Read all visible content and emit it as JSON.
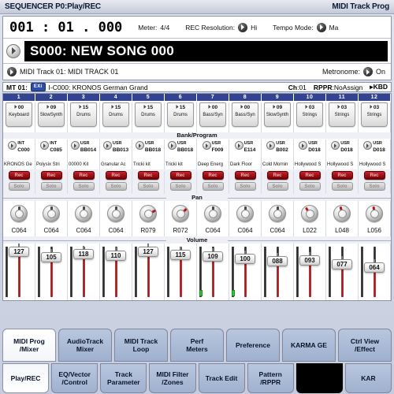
{
  "titlebar": {
    "left": "SEQUENCER P0:Play/REC",
    "right": "MIDI Track Prog"
  },
  "transport": {
    "locate": "001 : 01 . 000",
    "meter_label": "Meter:",
    "meter_value": "4/4",
    "rec_res_label": "REC Resolution:",
    "rec_res_value": "Hi",
    "tempo_mode_label": "Tempo Mode:",
    "tempo_mode_value": "Ma"
  },
  "song": {
    "name": "S000: NEW SONG 000"
  },
  "track_line": {
    "text": "MIDI Track 01: MIDI TRACK 01",
    "metronome_label": "Metronome:",
    "metronome_value": "On"
  },
  "mt_bar": {
    "mt": "MT 01:",
    "badge": "EXi",
    "program": "I-C000: KRONOS German Grand",
    "ch_label": "Ch",
    "ch_value": "01",
    "rppr_label": "RPPR",
    "rppr_value": "NoAssign",
    "kbd": "KBD"
  },
  "section_labels": {
    "bank_program": "Bank/Program",
    "pan": "Pan",
    "volume": "Volume"
  },
  "buttons": {
    "rec": "Rec",
    "solo": "Solo"
  },
  "channels": [
    {
      "num": "1",
      "cat_num": "00",
      "cat_name": "Keyboard",
      "bank": "INT",
      "prog": "C000",
      "prog_name": "KRONOS Ge",
      "pan": "C064",
      "pan_deg": 0,
      "vol": "127",
      "meter": false
    },
    {
      "num": "2",
      "cat_num": "09",
      "cat_name": "SlowSynth",
      "bank": "INT",
      "prog": "C085",
      "prog_name": "Polysix Stri",
      "pan": "C064",
      "pan_deg": 0,
      "vol": "105",
      "meter": false
    },
    {
      "num": "3",
      "cat_num": "15",
      "cat_name": "Drums",
      "bank": "USR",
      "prog": "BB014",
      "prog_name": "00000 Kit",
      "pan": "C064",
      "pan_deg": 0,
      "vol": "118",
      "meter": false
    },
    {
      "num": "4",
      "cat_num": "15",
      "cat_name": "Drums",
      "bank": "USR",
      "prog": "BB013",
      "prog_name": "Granular Ac",
      "pan": "C064",
      "pan_deg": 0,
      "vol": "110",
      "meter": false
    },
    {
      "num": "5",
      "cat_num": "15",
      "cat_name": "Drums",
      "bank": "USR",
      "prog": "BB018",
      "prog_name": "Tricki kit",
      "pan": "R079",
      "pan_deg": 60,
      "vol": "127",
      "meter": false
    },
    {
      "num": "6",
      "cat_num": "15",
      "cat_name": "Drums",
      "bank": "USR",
      "prog": "BB018",
      "prog_name": "Tricki kit",
      "pan": "R072",
      "pan_deg": 45,
      "vol": "115",
      "meter": false
    },
    {
      "num": "7",
      "cat_num": "00",
      "cat_name": "Bass/Syn",
      "bank": "USR",
      "prog": "F009",
      "prog_name": "Deep Energ",
      "pan": "C064",
      "pan_deg": 0,
      "vol": "109",
      "meter": true
    },
    {
      "num": "8",
      "cat_num": "00",
      "cat_name": "Bass/Syn",
      "bank": "USR",
      "prog": "E114",
      "prog_name": "Dark Floor",
      "pan": "C064",
      "pan_deg": 0,
      "vol": "100",
      "meter": true
    },
    {
      "num": "9",
      "cat_num": "09",
      "cat_name": "SlowSynth",
      "bank": "USR",
      "prog": "B002",
      "prog_name": "Cold Mornin",
      "pan": "C064",
      "pan_deg": 0,
      "vol": "088",
      "meter": false
    },
    {
      "num": "10",
      "cat_num": "03",
      "cat_name": "Strings",
      "bank": "USR",
      "prog": "D018",
      "prog_name": "Hollywood S",
      "pan": "L022",
      "pan_deg": -32,
      "vol": "093",
      "meter": false
    },
    {
      "num": "11",
      "cat_num": "03",
      "cat_name": "Strings",
      "bank": "USR",
      "prog": "D018",
      "prog_name": "Hollywood S",
      "pan": "L048",
      "pan_deg": -14,
      "vol": "077",
      "meter": false
    },
    {
      "num": "12",
      "cat_num": "03",
      "cat_name": "Strings",
      "bank": "USR",
      "prog": "D018",
      "prog_name": "Hollywood S",
      "pan": "L056",
      "pan_deg": -9,
      "vol": "064",
      "meter": false
    }
  ],
  "tabs_top": [
    {
      "l1": "MIDI Prog",
      "l2": "/Mixer",
      "selected": true
    },
    {
      "l1": "AudioTrack",
      "l2": "Mixer",
      "selected": false
    },
    {
      "l1": "MIDI Track",
      "l2": "Loop",
      "selected": false
    },
    {
      "l1": "Perf",
      "l2": "Meters",
      "selected": false
    },
    {
      "l1": "Preference",
      "l2": "",
      "selected": false
    },
    {
      "l1": "KARMA GE",
      "l2": "",
      "selected": false
    },
    {
      "l1": "Ctrl View",
      "l2": "/Effect",
      "selected": false
    }
  ],
  "tabs_bottom": [
    {
      "l1": "Play/REC",
      "l2": "",
      "selected": true,
      "blank": false
    },
    {
      "l1": "EQ/Vector",
      "l2": "/Control",
      "selected": false,
      "blank": false
    },
    {
      "l1": "Track",
      "l2": "Parameter",
      "selected": false,
      "blank": false
    },
    {
      "l1": "MIDI Filter",
      "l2": "/Zones",
      "selected": false,
      "blank": false
    },
    {
      "l1": "Track Edit",
      "l2": "",
      "selected": false,
      "blank": false
    },
    {
      "l1": "Pattern",
      "l2": "/RPPR",
      "selected": false,
      "blank": false
    },
    {
      "l1": "",
      "l2": "",
      "selected": false,
      "blank": true
    },
    {
      "l1": "KAR",
      "l2": "",
      "selected": false,
      "blank": false
    }
  ],
  "colors": {
    "accent": "#33438f",
    "rec": "#9b0f14",
    "fader": "#9e1014",
    "tab": "#9fb1cf"
  }
}
